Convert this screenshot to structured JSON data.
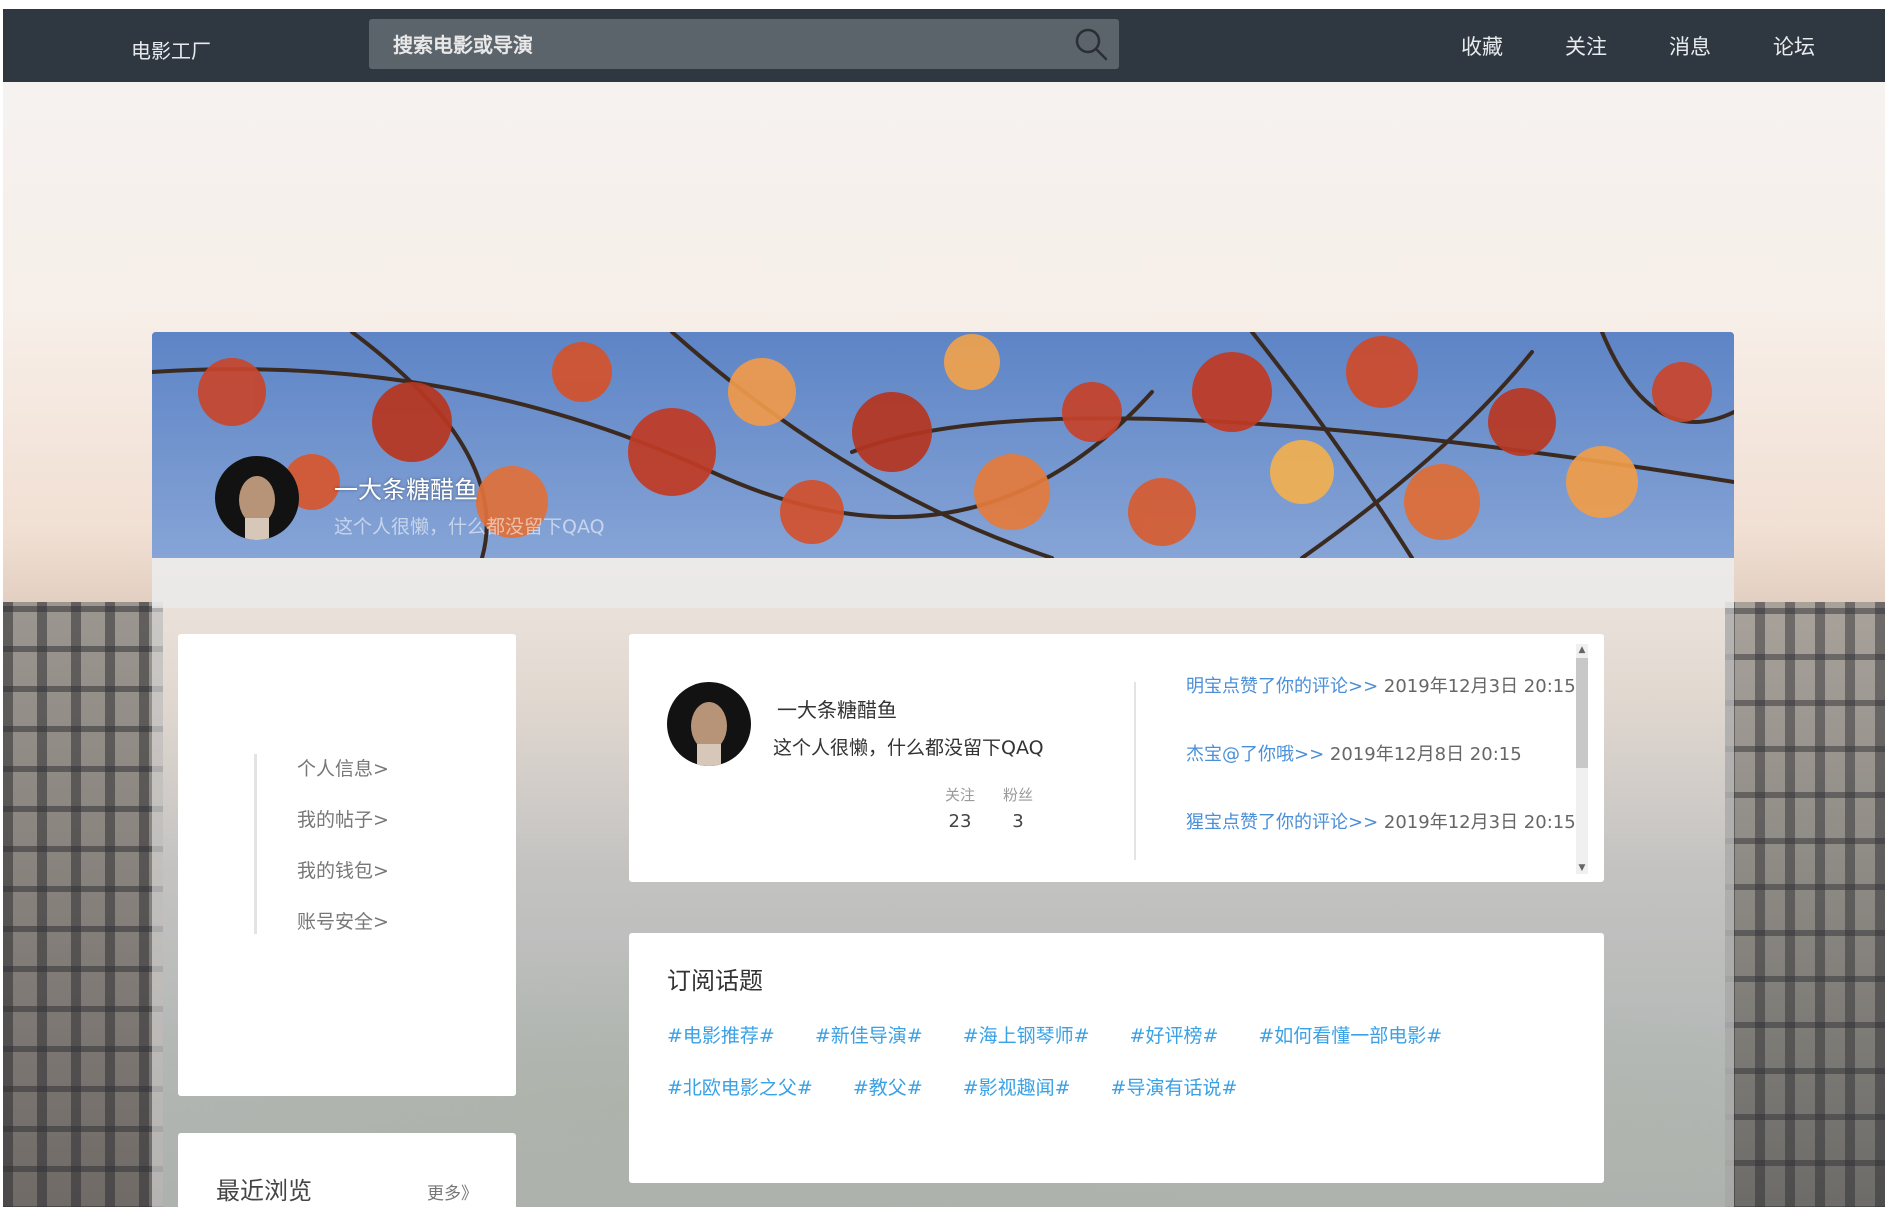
{
  "header": {
    "brand": "电影工厂",
    "search_placeholder": "搜索电影或导演",
    "nav": [
      "收藏",
      "关注",
      "消息",
      "论坛"
    ]
  },
  "cover": {
    "name": "一大条糖醋鱼",
    "bio": "这个人很懒，什么都没留下QAQ"
  },
  "sidebar": {
    "items": [
      "个人信息>",
      "我的帖子>",
      "我的钱包>",
      "账号安全>"
    ]
  },
  "recent": {
    "title": "最近浏览",
    "more": "更多》"
  },
  "profile": {
    "name": "一大条糖醋鱼",
    "bio": "这个人很懒，什么都没留下QAQ",
    "follow_label": "关注",
    "follow_count": "23",
    "fans_label": "粉丝",
    "fans_count": "3"
  },
  "notifications": [
    {
      "link": "明宝点赞了你的评论>>",
      "time": "2019年12月3日 20:15"
    },
    {
      "link": "杰宝@了你哦>>",
      "time": "2019年12月8日 20:15"
    },
    {
      "link": "猩宝点赞了你的评论>>",
      "time": "2019年12月3日 20:15"
    }
  ],
  "topics": {
    "title": "订阅话题",
    "row1": [
      "#电影推荐#",
      "#新佳导演#",
      "#海上钢琴师#",
      "#好评榜#",
      "#如何看懂一部电影#"
    ],
    "row2": [
      "#北欧电影之父#",
      "#教父#",
      "#影视趣闻#",
      "#导演有话说#"
    ]
  },
  "colors": {
    "topbar": "#2f3740",
    "search_bg": "#5b636b",
    "link_blue": "#4a8fd8",
    "topic_blue": "#3aa1e5"
  }
}
